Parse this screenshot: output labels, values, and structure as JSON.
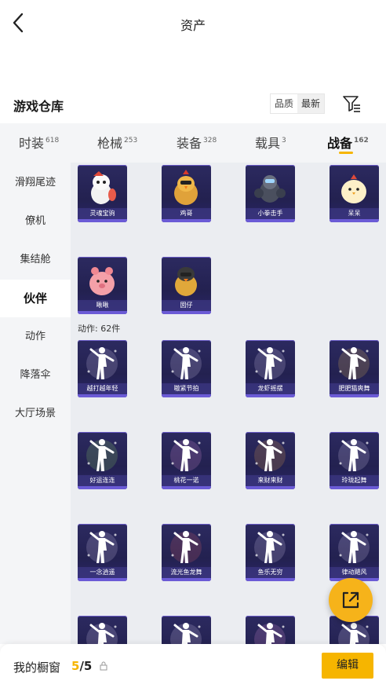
{
  "header": {
    "title": "资产",
    "back_icon": "chevron-left-icon"
  },
  "section": {
    "title": "游戏仓库",
    "sort_options": [
      "品质",
      "最新"
    ],
    "active_sort": "最新",
    "filter_icon": "filter-icon"
  },
  "tabs": [
    {
      "label": "时装",
      "count": "618"
    },
    {
      "label": "枪械",
      "count": "253"
    },
    {
      "label": "装备",
      "count": "328"
    },
    {
      "label": "载具",
      "count": "3"
    },
    {
      "label": "战备",
      "count": "162"
    }
  ],
  "active_tab": "战备",
  "sidebar": {
    "items": [
      "滑翔尾迹",
      "僚机",
      "集结舱",
      "伙伴",
      "动作",
      "降落伞",
      "大厅场景"
    ],
    "active": "伙伴"
  },
  "partners": [
    "灵魂宝驹",
    "鸡哥",
    "小拳击手",
    "呆呆",
    "啾啾",
    "囡仔"
  ],
  "actions_count_label": "动作: 62件",
  "actions": [
    "越打越年轻",
    "嗷紧节拍",
    "龙虾摇摆",
    "肥肥猫爽舞",
    "好运连连",
    "桃花一诺",
    "来财来财",
    "玲珑起舞",
    "一念逍遥",
    "流光鱼龙舞",
    "鱼乐无穷",
    "律动飓风",
    "",
    "",
    "",
    ""
  ],
  "bottom": {
    "label": "我的橱窗",
    "current": "5",
    "separator": "/",
    "total": "5",
    "edit_label": "编辑"
  },
  "colors": {
    "accent": "#f6b500",
    "card_bg": "#2c2a60",
    "card_edge": "#6b5bd6"
  },
  "fab_icon": "share-external-icon"
}
